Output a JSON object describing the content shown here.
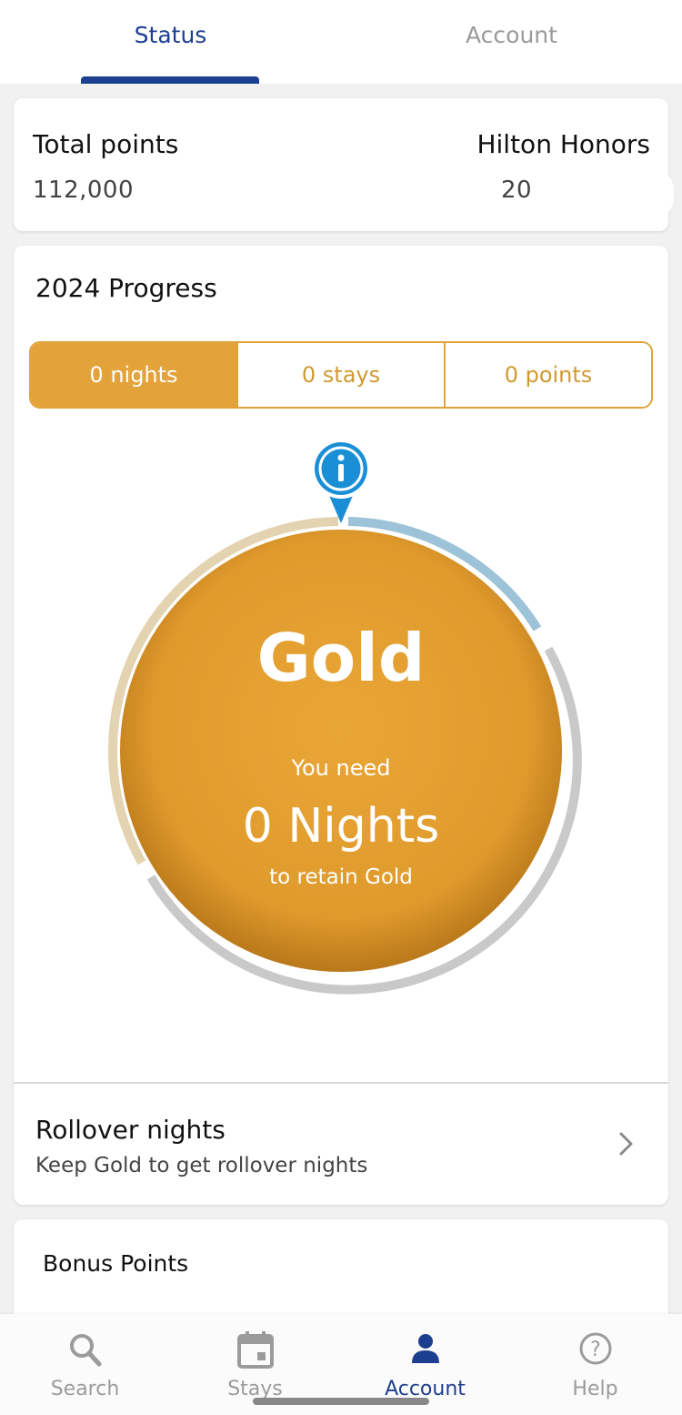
{
  "top_tabs": {
    "status": "Status",
    "account": "Account"
  },
  "points": {
    "total_label": "Total points",
    "total_value": "112,000",
    "program_label": "Hilton Honors",
    "member_number": "20"
  },
  "progress": {
    "title": "2024 Progress",
    "segments": {
      "nights": "0 nights",
      "stays": "0 stays",
      "points": "0 points"
    },
    "tier": "Gold",
    "need_text": "You need",
    "remaining": "0 Nights",
    "retain_text": "to retain Gold"
  },
  "rollover": {
    "title": "Rollover nights",
    "subtitle": "Keep Gold to get rollover nights"
  },
  "bonus": {
    "title": "Bonus Points"
  },
  "bottom_nav": {
    "search": "Search",
    "stays": "Stays",
    "account": "Account",
    "help": "Help"
  },
  "colors": {
    "brand_blue": "#1d3f8f",
    "gold": "#e4a23a",
    "info_blue": "#1a8fd6",
    "progress_blue": "#9cc3d8",
    "progress_tan": "#e3d3b0",
    "progress_gray": "#c9c9c9"
  },
  "icons": [
    "search-icon",
    "calendar-icon",
    "person-icon",
    "help-icon",
    "info-icon",
    "chevron-right-icon"
  ]
}
